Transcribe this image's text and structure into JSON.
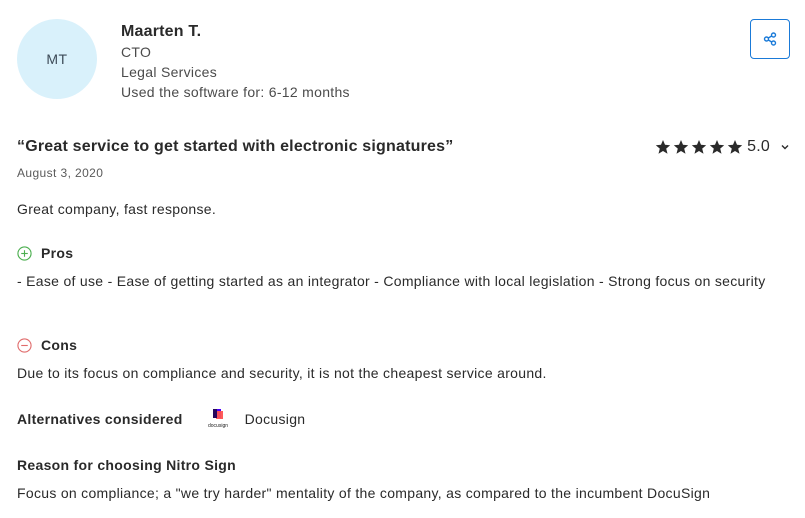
{
  "reviewer": {
    "initials": "MT",
    "name": "Maarten T.",
    "role": "CTO",
    "industry": "Legal Services",
    "usage": "Used the software for: 6-12 months"
  },
  "review": {
    "title": "“Great service to get started with electronic signatures”",
    "date": "August 3, 2020",
    "rating": "5.0",
    "stars": 5,
    "summary": "Great company, fast response.",
    "pros_label": "Pros",
    "pros_text": "- Ease of use - Ease of getting started as an integrator - Compliance with local legislation - Strong focus on security",
    "cons_label": "Cons",
    "cons_text": "Due to its focus on compliance and security, it is not the cheapest service around.",
    "alternatives_label": "Alternatives considered",
    "alternatives": [
      {
        "name": "Docusign",
        "logo_text": "docusign"
      }
    ],
    "reason_label": "Reason for choosing Nitro Sign",
    "reason_text": "Focus on compliance; a \"we try harder\" mentality of the company, as compared to the incumbent DocuSign"
  },
  "icons": {
    "share": "share-icon",
    "star": "star-icon",
    "chevron": "chevron-down-icon",
    "pros": "plus-circle-icon",
    "cons": "minus-circle-icon"
  },
  "colors": {
    "avatar_bg": "#d9f1fb",
    "accent": "#1a7ad8",
    "pros": "#4caf50",
    "cons": "#e06c6c",
    "star": "#2a2a2a"
  }
}
